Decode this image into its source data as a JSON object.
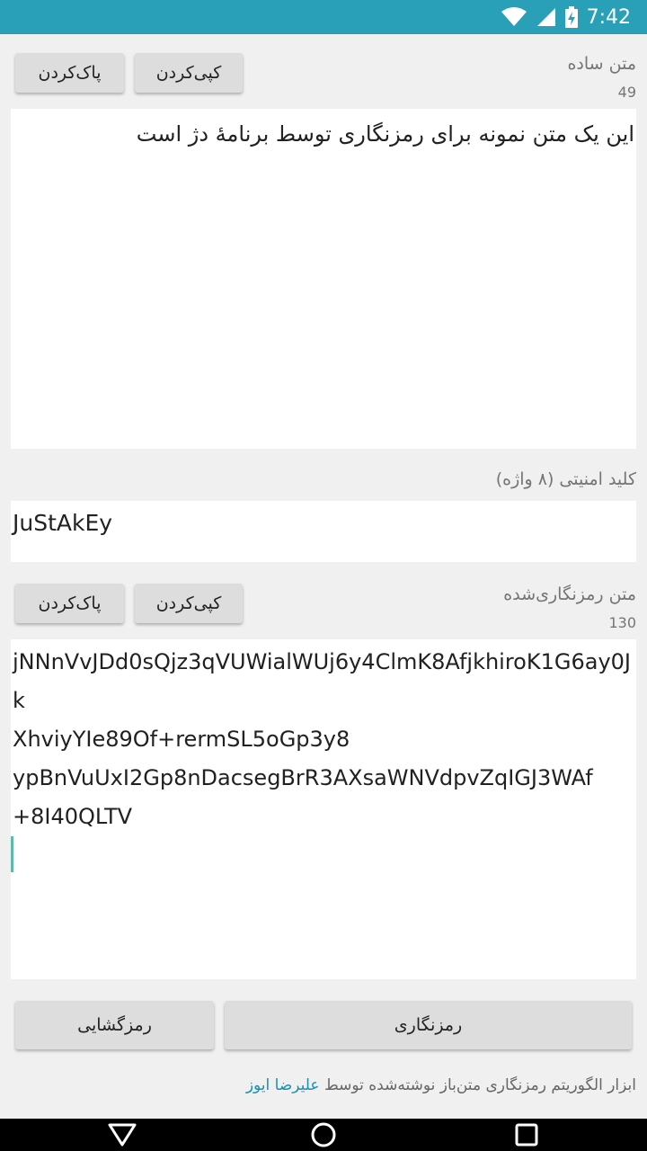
{
  "status_bar": {
    "time": "7:42",
    "icons": [
      "wifi-icon",
      "signal-icon",
      "battery-icon"
    ]
  },
  "plain_section": {
    "label": "متن ساده",
    "counter": "49",
    "copy_label": "کپی‌کردن",
    "clear_label": "پاک‌کردن",
    "text": "این یک متن نمونه برای رمزنگاری توسط برنامهٔ دژ است"
  },
  "key_section": {
    "label": "کلید امنیتی (۸ واژه)",
    "value": "JuStAkEy"
  },
  "cipher_section": {
    "label": "متن رمزنگاری‌شده",
    "counter": "130",
    "copy_label": "کپی‌کردن",
    "clear_label": "پاک‌کردن",
    "text": "jNNnVvJDd0sQjz3qVUWialWUj6y4ClmK8AfjkhiroK1G6ay0Jk\nXhviyYIe89Of+rermSL5oGp3y8\nypBnVuUxI2Gp8nDacsegBrR3AXsaWNVdpvZqIGJ3WAf\n+8I40QLTV"
  },
  "actions": {
    "encrypt_label": "رمزنگاری",
    "decrypt_label": "رمزگشایی"
  },
  "footer": {
    "text": "ابزار الگوریتم رمزنگاری متن‌باز نوشته‌شده توسط",
    "author": "علیرضا ایوز"
  },
  "nav_bar": {
    "icons": [
      "back-icon",
      "home-icon",
      "recents-icon"
    ]
  },
  "colors": {
    "status_bar": "#2aa0b8",
    "accent_link": "#1a8fb5",
    "cursor": "#5fb9a8"
  }
}
